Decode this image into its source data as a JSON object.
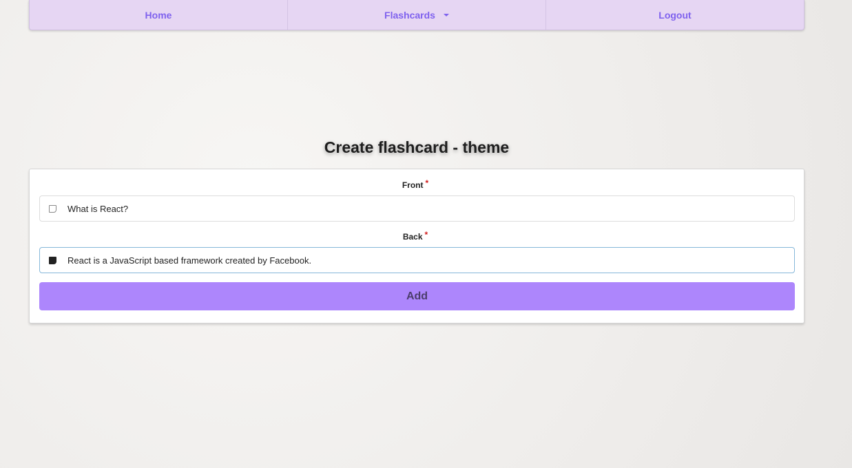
{
  "nav": {
    "items": [
      {
        "label": "Home"
      },
      {
        "label": "Flashcards",
        "icon": "caret-down-icon"
      },
      {
        "label": "Logout"
      }
    ]
  },
  "page": {
    "title": "Create flashcard - theme"
  },
  "form": {
    "front": {
      "label": "Front",
      "required_mark": "*",
      "value": "What is React?",
      "icon": "sticky-note-outline-icon"
    },
    "back": {
      "label": "Back",
      "required_mark": "*",
      "value": "React is a JavaScript based framework created by Facebook.",
      "icon": "sticky-note-filled-icon"
    },
    "submit_label": "Add"
  },
  "colors": {
    "nav_bg": "#e6d6f3",
    "nav_text": "#7f62ee",
    "button_bg": "#ad86fc",
    "required": "#d01919",
    "focus_border": "#85b7d9"
  }
}
